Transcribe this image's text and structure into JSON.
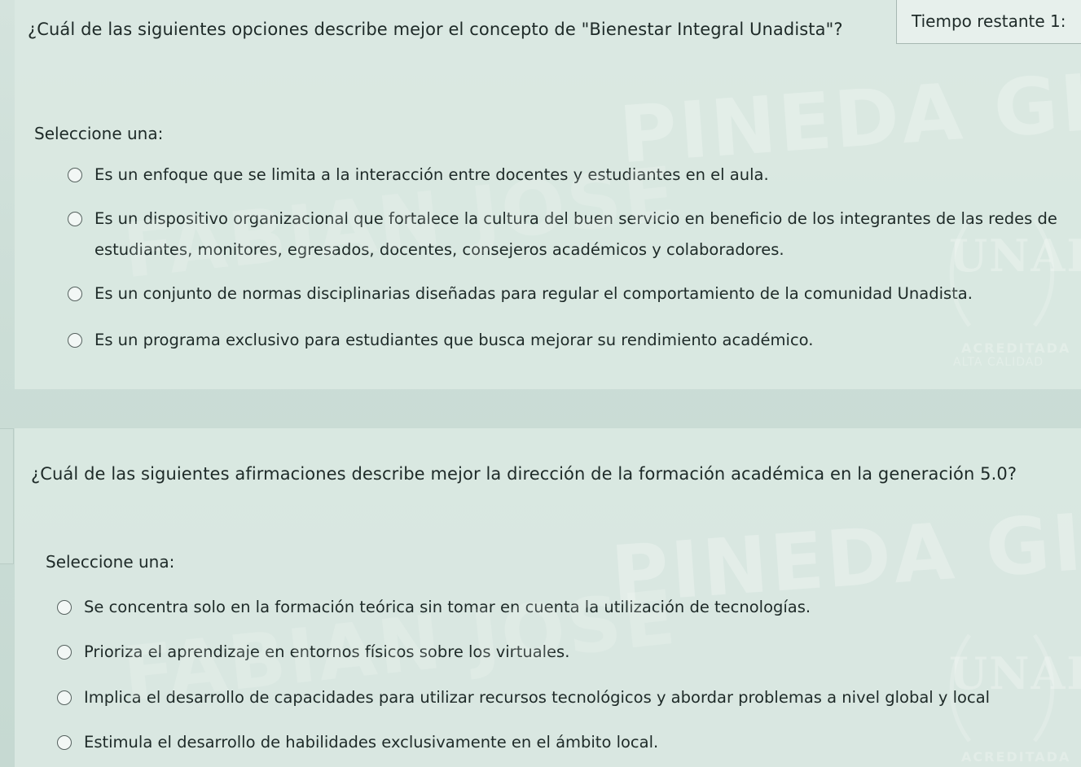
{
  "timer": {
    "label": "Tiempo restante 1:"
  },
  "questions": [
    {
      "text": "¿Cuál de las siguientes opciones describe mejor el concepto de \"Bienestar Integral Unadista\"?",
      "select_label": "Seleccione una:",
      "options": [
        {
          "label": "Es un enfoque que se limita a la interacción entre docentes y estudiantes en el aula."
        },
        {
          "label": "Es un dispositivo organizacional que fortalece la cultura del buen servicio en beneficio de los integrantes de las redes de estudiantes, monitores, egresados, docentes, consejeros académicos y colaboradores."
        },
        {
          "label": "Es un conjunto de normas disciplinarias diseñadas para regular el comportamiento de la comunidad Unadista."
        },
        {
          "label": "Es un programa exclusivo para estudiantes que busca mejorar su rendimiento académico."
        }
      ]
    },
    {
      "text": "¿Cuál de las siguientes afirmaciones describe mejor la dirección de la formación académica en la generación 5.0?",
      "select_label": "Seleccione una:",
      "options": [
        {
          "label": "Se concentra solo en la formación teórica sin tomar en cuenta la utilización de tecnologías."
        },
        {
          "label": "Prioriza el aprendizaje en entornos físicos sobre los virtuales."
        },
        {
          "label": "Implica el desarrollo de capacidades para utilizar recursos tecnológicos y abordar problemas a nivel global y local"
        },
        {
          "label": "Estimula el desarrollo de habilidades exclusivamente en el ámbito local."
        }
      ]
    }
  ],
  "watermarks": {
    "name_top": "PINEDA GIL",
    "name_bottom": "FABIAN JOSE",
    "logo_text": "UNAD",
    "accredited": "ACREDITADA",
    "quality": "ALTA CALIDAD"
  },
  "colors": {
    "background": "#c9dcd6",
    "card": "#dae8e2",
    "timer_bg": "#e7f0ec",
    "text": "#1e2a28"
  }
}
